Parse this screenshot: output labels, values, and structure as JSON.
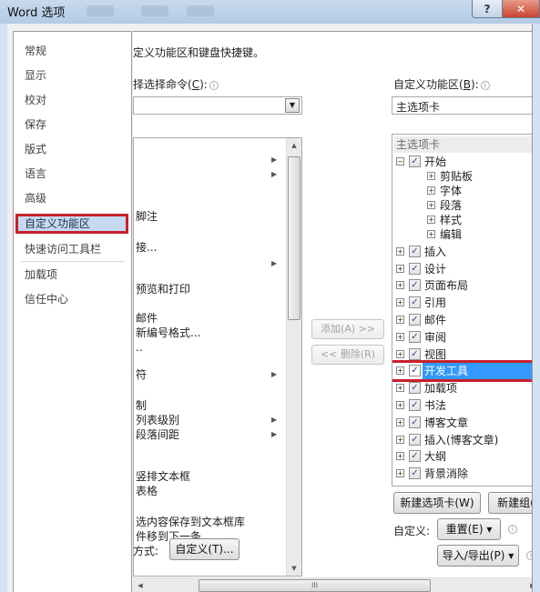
{
  "window": {
    "title": "Word 选项",
    "help_icon": "?",
    "close_icon": "✕"
  },
  "nav": {
    "items": [
      {
        "label": "常规"
      },
      {
        "label": "显示"
      },
      {
        "label": "校对"
      },
      {
        "label": "保存"
      },
      {
        "label": "版式"
      },
      {
        "label": "语言"
      },
      {
        "label": "高级"
      },
      {
        "label": "自定义功能区",
        "selected": true
      },
      {
        "label": "快速访问工具栏"
      },
      {
        "label": "加载项"
      },
      {
        "label": "信任中心"
      }
    ]
  },
  "main": {
    "heading": "定义功能区和键盘快捷键。",
    "choose_label": "择选择命令",
    "choose_key": "C",
    "choose_value": "",
    "commands": [
      {
        "label": "",
        "submenu": true
      },
      {
        "label": "",
        "submenu": true
      },
      {
        "label": "脚注"
      },
      {
        "label": "接..."
      },
      {
        "label": "",
        "submenu": true
      },
      {
        "label": "预览和打印"
      },
      {
        "label": "邮件"
      },
      {
        "label": "新编号格式..."
      },
      {
        "label": ".."
      },
      {
        "label": "符",
        "submenu": true
      },
      {
        "label": "制"
      },
      {
        "label": "列表级别",
        "submenu": true
      },
      {
        "label": "段落间距",
        "submenu": true
      },
      {
        "label": "竖排文本框"
      },
      {
        "label": "表格"
      },
      {
        "label": "选内容保存到文本框库"
      },
      {
        "label": "件移到下一条"
      }
    ],
    "add_button": "添加(A) >>",
    "remove_button": "<< 删除(R)",
    "shortcut_label": "方式:",
    "customize_button": "自定义(T)...",
    "ribbon_label": "自定义功能区",
    "ribbon_key": "B",
    "ribbon_value": "主选项卡",
    "tree_header": "主选项卡",
    "tree": [
      {
        "label": "开始",
        "level": 0,
        "expanded": true,
        "checked": true
      },
      {
        "label": "剪贴板",
        "level": 1
      },
      {
        "label": "字体",
        "level": 1
      },
      {
        "label": "段落",
        "level": 1
      },
      {
        "label": "样式",
        "level": 1
      },
      {
        "label": "编辑",
        "level": 1
      },
      {
        "label": "插入",
        "level": 0,
        "checked": true
      },
      {
        "label": "设计",
        "level": 0,
        "checked": true
      },
      {
        "label": "页面布局",
        "level": 0,
        "checked": true
      },
      {
        "label": "引用",
        "level": 0,
        "checked": true
      },
      {
        "label": "邮件",
        "level": 0,
        "checked": true
      },
      {
        "label": "审阅",
        "level": 0,
        "checked": true
      },
      {
        "label": "视图",
        "level": 0,
        "checked": true
      },
      {
        "label": "开发工具",
        "level": 0,
        "checked": true,
        "selected": true
      },
      {
        "label": "加载项",
        "level": 0,
        "checked": true
      },
      {
        "label": "书法",
        "level": 0,
        "checked": true
      },
      {
        "label": "博客文章",
        "level": 0,
        "checked": true
      },
      {
        "label": "插入(博客文章)",
        "level": 0,
        "checked": true
      },
      {
        "label": "大纲",
        "level": 0,
        "checked": true
      },
      {
        "label": "背景消除",
        "level": 0,
        "checked": true
      }
    ],
    "new_tab_button": "新建选项卡(W)",
    "new_group_button": "新建组(",
    "customize_label": "自定义:",
    "reset_button": "重置(E) ▾",
    "import_export_button": "导入/导出(P) ▾"
  },
  "colors": {
    "highlight_box": "#c8202a",
    "selection_blue": "#3399ff",
    "nav_selected": "#c5d9f1"
  }
}
